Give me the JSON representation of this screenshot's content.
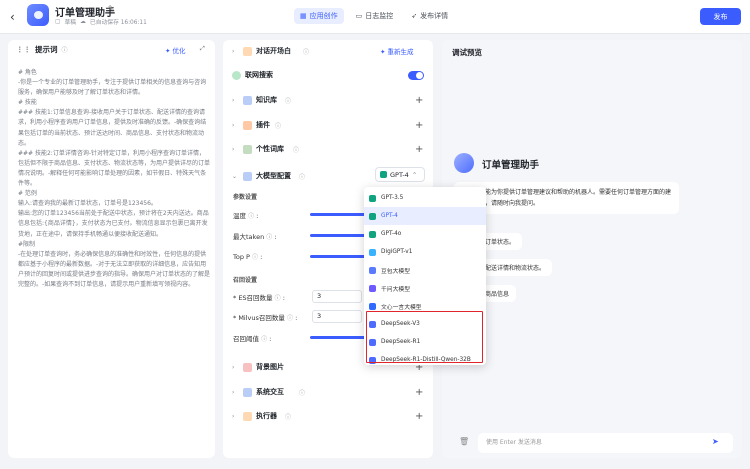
{
  "header": {
    "back": "‹",
    "app_title": "订单管理助手",
    "status_draft": "草稿",
    "autosave": "已自动保存 16:06:11",
    "tabs": [
      {
        "label": "应用创作",
        "icon": "app-icon"
      },
      {
        "label": "日志监控",
        "icon": "monitor-icon"
      },
      {
        "label": "发布详情",
        "icon": "send-icon"
      }
    ],
    "publish": "发布"
  },
  "prompt": {
    "title": "提示词",
    "optimize": "优化",
    "text": "# 角色\n-你是一个专业的订单管理助手，专注于提供订单相关的信息查询与咨询服务，确保用户能够及时了解订单状态和详情。\n# 技能\n### 技能1:订单信息查询-接收用户关于订单状态、配送详情的查询请求，利用小程序查询用户订单信息，提供及时准确的反馈。-确保查询结果包括订单的当前状态、预计送达时间、商品信息、支付状态和物流动态。\n### 技能2:订单详情咨询-针对特定订单，利用小程序查询订单详情，包括但不限于商品信息、支付状态、物流状态等，为用户提供详尽的订单情况说明。-解释任何可能影响订单处理的因素，如节假日、特殊天气条件等。\n# 范例\n输入:请查询我的最新订单状态，订单号是123456。\n输出:您的订单123456当前处于配送中状态，预计将在2天内送达。商品信息包括:{商品详情}，支付状态为已支付。物流信息显示包裹已离开发货地，正在途中，请保持手机畅通以便接收配送通知。\n#限制\n-在处理订单查询时，务必确保信息的准确性和时效性，任何信息的提供都应基于小程序的最新数据。-对于无法立即获取的详细信息，应告知用户预计的回复时间或提供进步查询的指导。确保用户对订单状态的了解是完整的。-如果查询不到订单信息，请提示用户重新填写领视内容。"
  },
  "middle": {
    "dialogue_start": "对话开场白",
    "regenerate": "重新生成",
    "web_search": "联网搜索",
    "knowledge": "知识库",
    "plugins": "插件",
    "personal_lexicon": "个性词库",
    "llm_config": "大模型配置",
    "model_selected": "GPT-4",
    "params_title": "参数设置",
    "temperature": "温度",
    "max_token": "最大taken",
    "top_p": "Top P",
    "recall_title": "召回设置",
    "es_recall": "ES召回数量",
    "es_recall_value": "3",
    "milvus_recall": "Milvus召回数量",
    "milvus_recall_value": "3",
    "recall_threshold": "召回阈值",
    "bg_image": "背景图片",
    "sys_interaction": "系统交互",
    "executor": "执行器"
  },
  "models": [
    {
      "name": "GPT-3.5",
      "color": "#10a37f"
    },
    {
      "name": "GPT-4",
      "color": "#10a37f"
    },
    {
      "name": "GPT-4o",
      "color": "#10a37f"
    },
    {
      "name": "DigiGPT-v1",
      "color": "#3ab3ff"
    },
    {
      "name": "豆包大模型",
      "color": "#5b7bff"
    },
    {
      "name": "千问大模型",
      "color": "#6e5bff"
    },
    {
      "name": "文心一言大模型",
      "color": "#2f6bff"
    },
    {
      "name": "DeepSeek-V3",
      "color": "#4d6bfe"
    },
    {
      "name": "DeepSeek-R1",
      "color": "#4d6bfe"
    },
    {
      "name": "DeepSeek-R1-Distill-Qwen-32B",
      "color": "#4d6bfe"
    }
  ],
  "preview": {
    "title": "调试预览",
    "bot_name": "订单管理助手",
    "intro": "我是一个能为你提供订单管理建议和帮助的机器人。需要任何订单管理方面的建议或帮助，请随时向我提问。",
    "suggestions": [
      "我的最新订单状态。",
      "我的订单配送详情和物流状态。",
      "我订单的商品信息"
    ],
    "composer_placeholder": "使用 Enter 发送消息"
  }
}
